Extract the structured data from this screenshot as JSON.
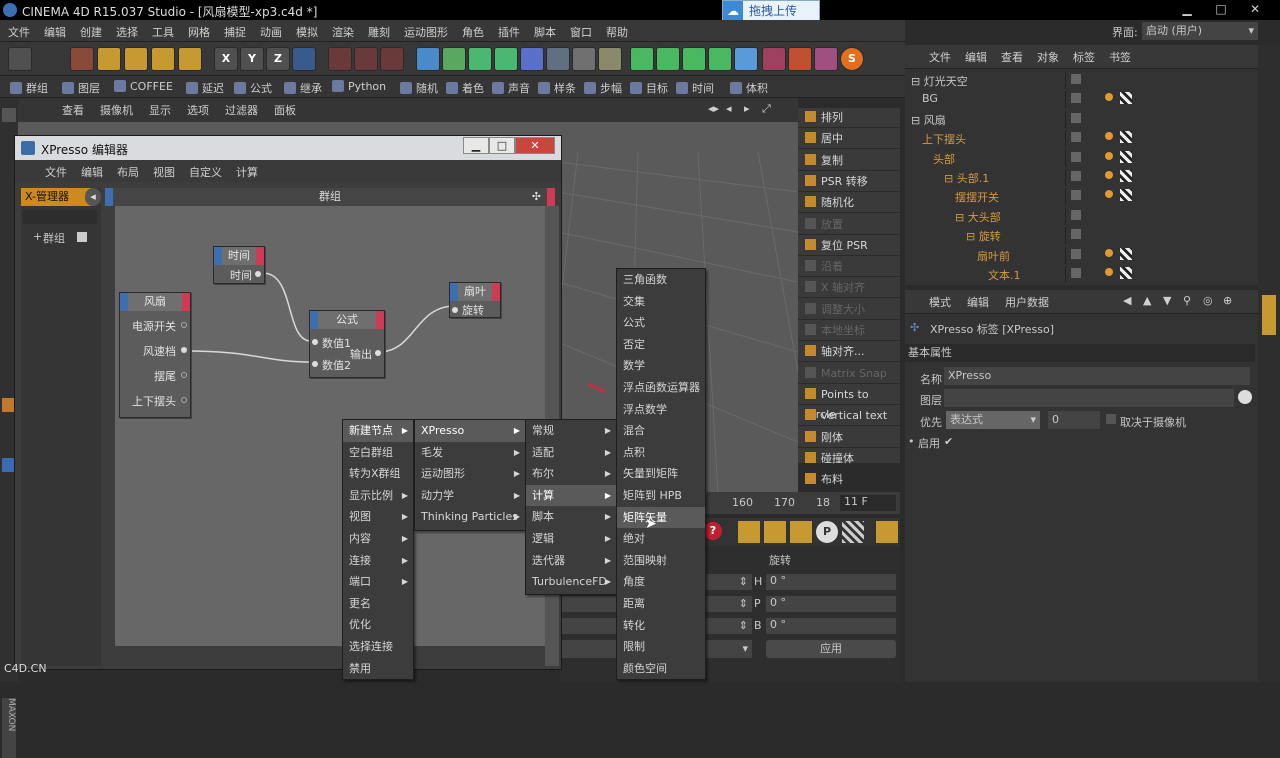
{
  "window": {
    "title": "CINEMA 4D R15.037 Studio - [风扇模型-xp3.c4d *]",
    "minimize": "▁",
    "maximize": "□",
    "close": "✕"
  },
  "upload_button": "拖拽上传",
  "layout_label": "界面:",
  "layout_value": "启动 (用户)",
  "main_menu": [
    "文件",
    "编辑",
    "创建",
    "选择",
    "工具",
    "网格",
    "捕捉",
    "动画",
    "模拟",
    "渲染",
    "雕刻",
    "运动图形",
    "角色",
    "插件",
    "脚本",
    "窗口",
    "帮助"
  ],
  "toolbar2": [
    "群组",
    "图层",
    "COFFEE",
    "延迟",
    "公式",
    "继承",
    "Python",
    "随机",
    "着色",
    "声音",
    "样条",
    "步幅",
    "目标",
    "时间",
    "体积"
  ],
  "viewport_menu": [
    "查看",
    "摄像机",
    "显示",
    "选项",
    "过滤器",
    "面板"
  ],
  "right_ribbon": [
    {
      "label": "排列",
      "dim": false
    },
    {
      "label": "居中",
      "dim": false
    },
    {
      "label": "复制",
      "dim": false
    },
    {
      "label": "PSR 转移",
      "dim": false
    },
    {
      "label": "随机化",
      "dim": false
    },
    {
      "label": "放置",
      "dim": true
    },
    {
      "label": "复位 PSR",
      "dim": false
    },
    {
      "label": "沿着",
      "dim": true
    },
    {
      "label": "X 轴对齐",
      "dim": true
    },
    {
      "label": "调整大小",
      "dim": true
    },
    {
      "label": "本地坐标",
      "dim": true
    },
    {
      "label": "轴对齐...",
      "dim": false
    },
    {
      "label": "Matrix Snap",
      "dim": true
    },
    {
      "label": "Points to Circle",
      "dim": false
    },
    {
      "label": "vertical text",
      "dim": false
    },
    {
      "label": "刚体",
      "dim": false
    },
    {
      "label": "碰撞体",
      "dim": false
    },
    {
      "label": "布料",
      "dim": false
    }
  ],
  "timeline": {
    "ticks": [
      "160",
      "170",
      "18"
    ],
    "frame": "11 F"
  },
  "coords": {
    "header": "旋转",
    "rows": [
      {
        "axis": "H",
        "value": "0 °"
      },
      {
        "axis": "P",
        "value": "0 °"
      },
      {
        "axis": "B",
        "value": "0 °"
      }
    ],
    "apply": "应用"
  },
  "object_manager": {
    "menu": [
      "文件",
      "编辑",
      "查看",
      "对象",
      "标签",
      "书签"
    ],
    "objects": [
      {
        "name": "灯光天空",
        "indent": 0,
        "color": "#c8c8c8"
      },
      {
        "name": "BG",
        "indent": 1,
        "color": "#c8c8c8"
      },
      {
        "name": "风扇",
        "indent": 0,
        "color": "#c8c8c8"
      },
      {
        "name": "上下摆头",
        "indent": 1,
        "color": "#d89a40"
      },
      {
        "name": "头部",
        "indent": 2,
        "color": "#d89a40"
      },
      {
        "name": "头部.1",
        "indent": 3,
        "color": "#d89a40"
      },
      {
        "name": "摆摆开关",
        "indent": 4,
        "color": "#d89a40"
      },
      {
        "name": "大头部",
        "indent": 4,
        "color": "#d89a40"
      },
      {
        "name": "旋转",
        "indent": 5,
        "color": "#d89a40"
      },
      {
        "name": "扇叶前",
        "indent": 6,
        "color": "#d89a40"
      },
      {
        "name": "文本.1",
        "indent": 7,
        "color": "#d89a40"
      }
    ]
  },
  "attributes": {
    "menu": [
      "模式",
      "编辑",
      "用户数据"
    ],
    "tag_title": "XPresso 标签 [XPresso]",
    "section": "基本属性",
    "name_label": "名称",
    "name_value": "XPresso",
    "layer_label": "图层",
    "priority_label": "优先",
    "priority_value": "表达式",
    "priority_num": "0",
    "camera_dep": "取决于摄像机",
    "enable_label": "启用",
    "enable_value": "✔"
  },
  "xpresso": {
    "title": "XPresso 编辑器",
    "menu": [
      "文件",
      "编辑",
      "布局",
      "视图",
      "自定义",
      "计算"
    ],
    "manager_label": "X-管理器",
    "group_bar": "群组",
    "tree_item": "群组",
    "nodes": {
      "time": {
        "title": "时间",
        "out": "时间"
      },
      "fan": {
        "title": "风扇",
        "outs": [
          "电源开关",
          "风速档",
          "摆尾",
          "上下摆头"
        ]
      },
      "formula": {
        "title": "公式",
        "ins": [
          "数值1",
          "数值2"
        ],
        "out": "输出"
      },
      "blade": {
        "title": "扇叶",
        "in": "旋转"
      }
    }
  },
  "context_menus": {
    "main": [
      "新建节点",
      "空白群组",
      "转为X群组",
      "显示比例",
      "视图",
      "内容",
      "连接",
      "端口",
      "更名",
      "优化",
      "选择连接",
      "禁用"
    ],
    "main_arrows": [
      true,
      false,
      false,
      true,
      true,
      true,
      true,
      true,
      false,
      false,
      false,
      false
    ],
    "sub1": [
      "XPresso",
      "毛发",
      "运动图形",
      "动力学",
      "Thinking Particles"
    ],
    "sub2": [
      "常规",
      "适配",
      "布尔",
      "计算",
      "脚本",
      "逻辑",
      "迭代器",
      "TurbulenceFD"
    ],
    "sub3": [
      "三角函数",
      "交集",
      "公式",
      "否定",
      "数学",
      "浮点函数运算器",
      "浮点数学",
      "混合",
      "点积",
      "矢量到矩阵",
      "矩阵到 HPB",
      "矩阵矢量",
      "绝对",
      "范围映射",
      "角度",
      "距离",
      "转化",
      "限制",
      "颜色空间"
    ]
  },
  "watermark": "C4D.CN"
}
